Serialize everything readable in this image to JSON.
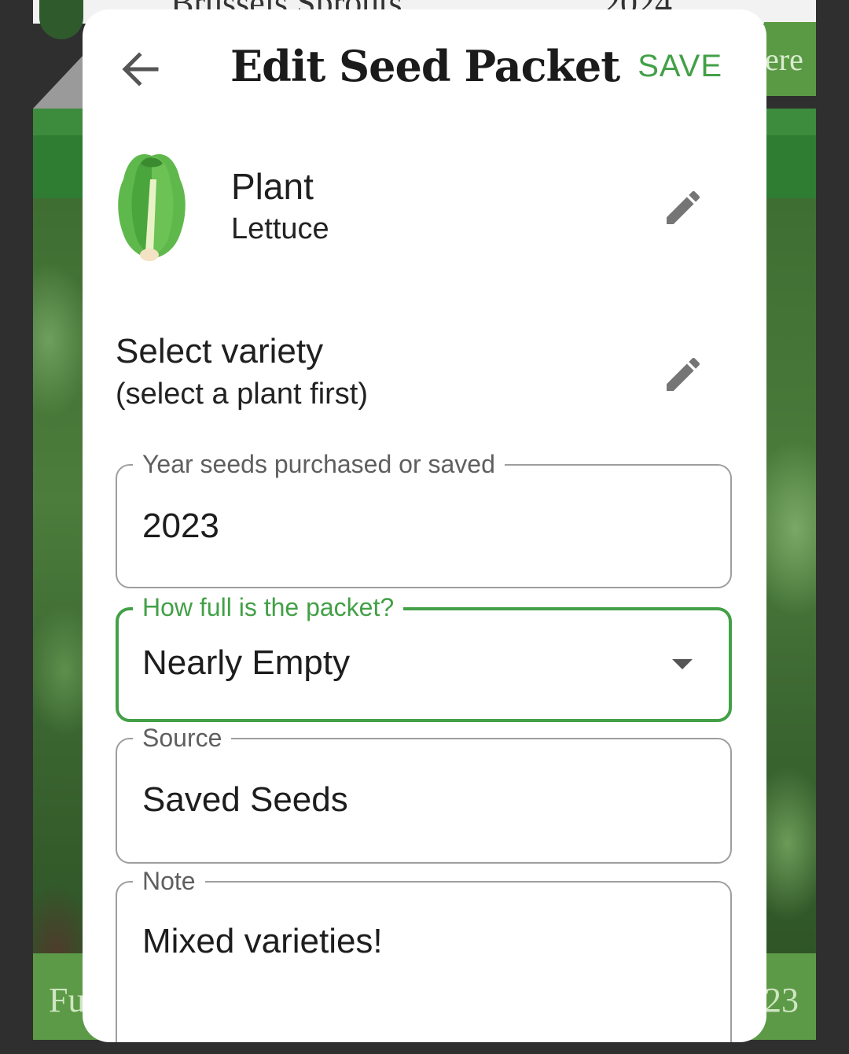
{
  "background": {
    "top_item_name": "Brussels Sprouts",
    "top_item_year": "2024",
    "right_partial_label": "ere",
    "bottom_left_partial": "Fu",
    "bottom_right_partial": "23"
  },
  "dialog": {
    "title": "Edit Seed Packet",
    "save_label": "SAVE",
    "back_icon": "arrow-left-icon",
    "accent_color": "#43a047"
  },
  "plant": {
    "label": "Plant",
    "value": "Lettuce",
    "icon": "lettuce-icon"
  },
  "variety": {
    "label": "Select variety",
    "hint": "(select a plant first)"
  },
  "fields": {
    "year": {
      "label": "Year seeds purchased or saved",
      "value": "2023"
    },
    "fullness": {
      "label": "How full is the packet?",
      "value": "Nearly Empty"
    },
    "source": {
      "label": "Source",
      "value": "Saved Seeds"
    },
    "note": {
      "label": "Note",
      "value": "Mixed varieties!"
    }
  }
}
